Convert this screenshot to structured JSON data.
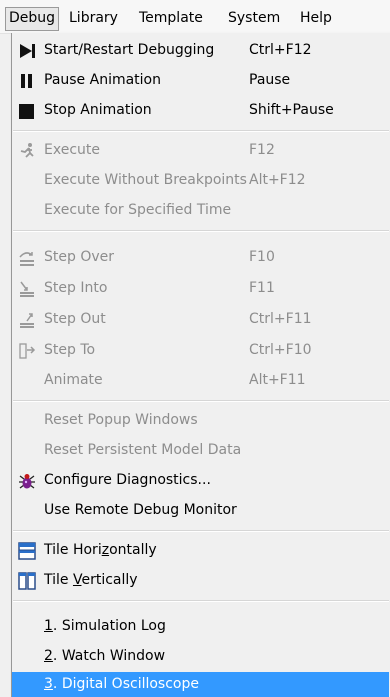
{
  "menubar": {
    "items": [
      "Debug",
      "Library",
      "Template",
      "System",
      "Help"
    ]
  },
  "menu": {
    "start_debugging": {
      "label": "Start/Restart Debugging",
      "shortcut": "Ctrl+F12",
      "icon": "play-step-icon"
    },
    "pause_animation": {
      "label": "Pause Animation",
      "shortcut": "Pause",
      "icon": "pause-icon"
    },
    "stop_animation": {
      "label": "Stop Animation",
      "shortcut": "Shift+Pause",
      "icon": "stop-icon"
    },
    "execute": {
      "label": "Execute",
      "shortcut": "F12",
      "icon": "run-figure-icon"
    },
    "execute_no_bp": {
      "label": "Execute Without Breakpoints",
      "shortcut": "Alt+F12"
    },
    "execute_time": {
      "label": "Execute for Specified Time"
    },
    "step_over": {
      "label": "Step Over",
      "shortcut": "F10",
      "icon": "step-over-icon"
    },
    "step_into": {
      "label": "Step Into",
      "shortcut": "F11",
      "icon": "step-into-icon"
    },
    "step_out": {
      "label": "Step Out",
      "shortcut": "Ctrl+F11",
      "icon": "step-out-icon"
    },
    "step_to": {
      "label": "Step To",
      "shortcut": "Ctrl+F10",
      "icon": "step-to-icon"
    },
    "animate": {
      "label": "Animate",
      "shortcut": "Alt+F11"
    },
    "reset_popups": {
      "label": "Reset Popup Windows"
    },
    "reset_model": {
      "label": "Reset Persistent Model Data"
    },
    "configure_diag": {
      "label": "Configure Diagnostics...",
      "icon": "bug-icon"
    },
    "remote_monitor": {
      "label": "Use Remote Debug Monitor"
    },
    "tile_h": {
      "pre": "Tile Hori",
      "ul": "z",
      "post": "ontally",
      "icon": "tile-horizontal-icon"
    },
    "tile_v": {
      "pre": "Tile ",
      "ul": "V",
      "post": "ertically",
      "icon": "tile-vertical-icon"
    },
    "win1": {
      "ul": "1",
      "post": ". Simulation Log"
    },
    "win2": {
      "ul": "2",
      "post": ". Watch Window"
    },
    "win3": {
      "ul": "3",
      "post": ". Digital Oscilloscope"
    }
  },
  "colors": {
    "highlight": "#3399ff",
    "disabled": "#8d8d8d"
  }
}
